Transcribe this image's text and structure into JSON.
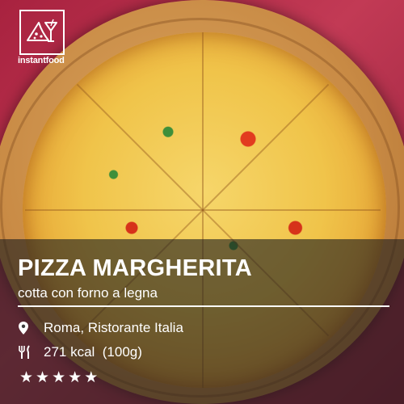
{
  "brand": {
    "name": "instantfood",
    "logo_icon": "pizza-cocktail-icon"
  },
  "dish": {
    "title": "PIZZA MARGHERITA",
    "subtitle": "cotta con forno a legna"
  },
  "details": {
    "location_icon": "map-pin-icon",
    "location": "Roma, Ristorante Italia",
    "calories_icon": "fork-knife-icon",
    "calories": "271 kcal  (100g)"
  },
  "rating": {
    "stars": 5,
    "max": 5,
    "star_glyph": "★"
  },
  "colors": {
    "background": "#a8223f",
    "panel": "#1e1e1e",
    "text": "#ffffff"
  }
}
